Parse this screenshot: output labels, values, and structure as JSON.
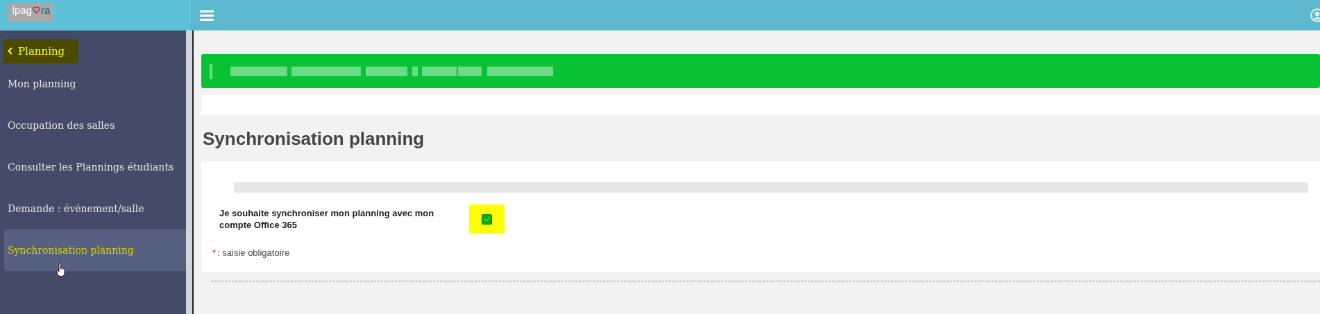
{
  "header": {
    "logo": {
      "text_before": "lpag",
      "text_after": "ra"
    }
  },
  "sidebar": {
    "back_label": "Planning",
    "items": [
      {
        "label": "Mon planning",
        "selected": false
      },
      {
        "label": "Occupation des salles",
        "selected": false
      },
      {
        "label": "Consulter les Plannings étudiants",
        "selected": false
      },
      {
        "label": "Demande : événement/salle",
        "selected": false
      },
      {
        "label": "Synchronisation planning",
        "selected": true
      }
    ]
  },
  "page": {
    "title": "Synchronisation planning",
    "form": {
      "label": "Je souhaite synchroniser mon planning avec mon compte Office 365",
      "checked": true,
      "required_mark": "*",
      "required_note": ": saisie obligatoire"
    }
  }
}
